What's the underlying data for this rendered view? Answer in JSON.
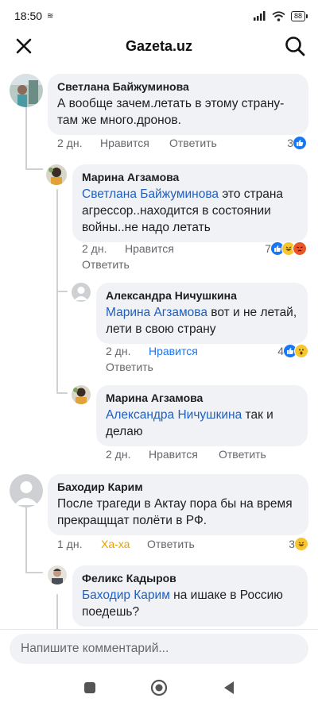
{
  "status": {
    "time": "18:50",
    "battery": "88"
  },
  "header": {
    "title": "Gazeta.uz"
  },
  "comments": [
    {
      "author": "Светлана Байжуминова",
      "text": "А вообще зачем.летать в этому страну-там же много.дронов.",
      "time": "2 дн.",
      "like": "Нравится",
      "reply": "Ответить",
      "reaction_count": "3",
      "reaction_icons": [
        "like-icon"
      ]
    },
    {
      "author": "Марина Агзамова",
      "mention": "Светлана Байжуминова",
      "text": " это страна агрессор..находится в состоянии войны..не надо летать",
      "time": "2 дн.",
      "like": "Нравится",
      "reply": "Ответить",
      "reaction_count": "7",
      "reaction_icons": [
        "like-icon",
        "haha-icon",
        "angry-icon"
      ]
    },
    {
      "author": "Александра Ничушкина",
      "mention": "Марина Агзамова",
      "text": " вот и не летай, лети в свою страну",
      "time": "2 дн.",
      "like": "Нравится",
      "reply": "Ответить",
      "reaction_count": "4",
      "reaction_icons": [
        "like-icon",
        "wow-icon"
      ]
    },
    {
      "author": "Марина Агзамова",
      "mention": "Александра Ничушкина",
      "text": " так и делаю",
      "time": "2 дн.",
      "like": "Нравится",
      "reply": "Ответить"
    },
    {
      "author": "Баходир Карим",
      "text": "После трагеди в Актау пора бы на время прекращщат полёти в РФ.",
      "time": "1 дн.",
      "like": "Ха-ха",
      "reply": "Ответить",
      "reaction_count": "3",
      "reaction_icons": [
        "haha-icon"
      ]
    },
    {
      "author": "Феликс Кадыров",
      "mention": "Баходир Карим",
      "text": " на ишаке в Россию поедешь?"
    }
  ],
  "input": {
    "placeholder": "Напишите комментарий..."
  },
  "colors": {
    "mention": "#1f5fbf",
    "like_active": "#1877f2",
    "haha_active": "#e5a100",
    "bubble": "#f0f2f5",
    "meta": "#65676b"
  },
  "nav": {
    "icons": [
      "recents-icon",
      "home-icon",
      "back-icon"
    ]
  }
}
